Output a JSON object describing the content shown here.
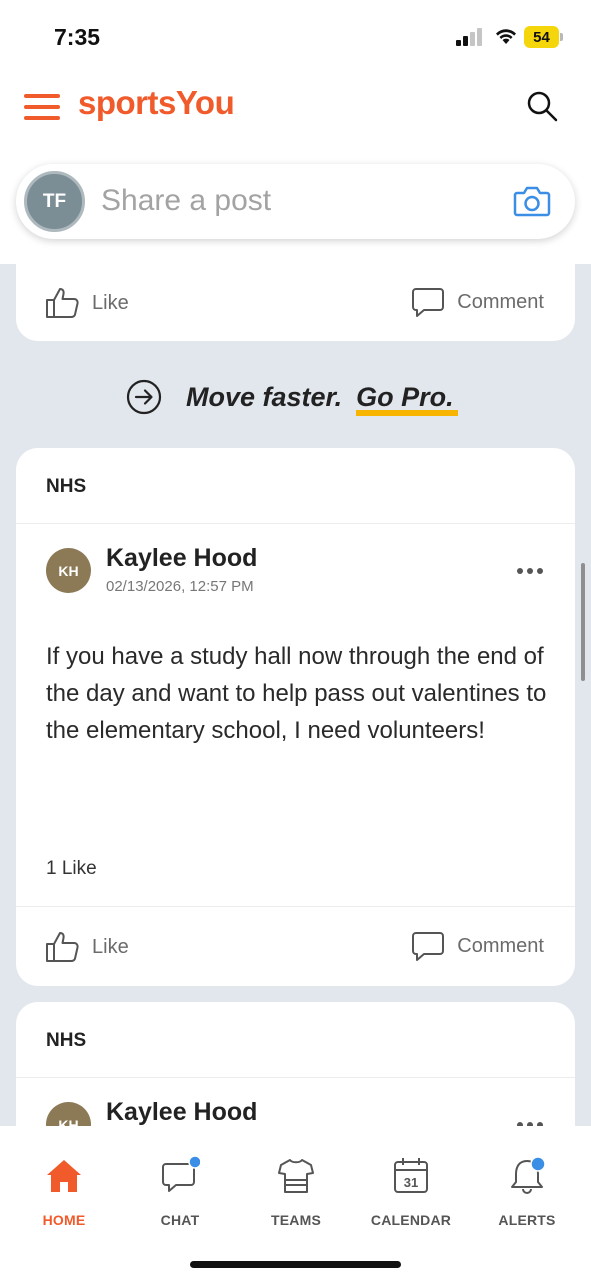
{
  "status_bar": {
    "time": "7:35",
    "battery": "54",
    "battery_color": "#f5d60a"
  },
  "header": {
    "brand": "sportsYou",
    "brand_color": "#f15a2a",
    "menu_icon": "hamburger-icon",
    "search_icon": "search-icon"
  },
  "composer": {
    "avatar_initials": "TF",
    "placeholder": "Share a post",
    "camera_icon": "camera-icon"
  },
  "feed": {
    "top_card": {
      "like_label": "Like",
      "comment_label": "Comment"
    },
    "promo": {
      "text": "Move faster.",
      "link": "Go Pro.",
      "highlight_color": "#f7b500"
    },
    "posts": [
      {
        "group": "NHS",
        "author_initials": "KH",
        "author": "Kaylee Hood",
        "timestamp": "02/13/2026, 12:57 PM",
        "body": "If you have a study hall now through the end of the day and want to help pass out valentines to the elementary school, I need volunteers!",
        "like_count": "1 Like",
        "like_label": "Like",
        "comment_label": "Comment"
      },
      {
        "group": "NHS",
        "author_initials": "KH",
        "author": "Kaylee Hood"
      }
    ]
  },
  "tab_bar": {
    "active": "HOME",
    "accent": "#f15a2a",
    "tabs": [
      {
        "label": "HOME",
        "icon": "home-icon"
      },
      {
        "label": "CHAT",
        "icon": "chat-icon",
        "badge": true
      },
      {
        "label": "TEAMS",
        "icon": "jersey-icon"
      },
      {
        "label": "CALENDAR",
        "icon": "calendar-icon",
        "date": "31"
      },
      {
        "label": "ALERTS",
        "icon": "bell-icon",
        "badge": true
      }
    ]
  }
}
